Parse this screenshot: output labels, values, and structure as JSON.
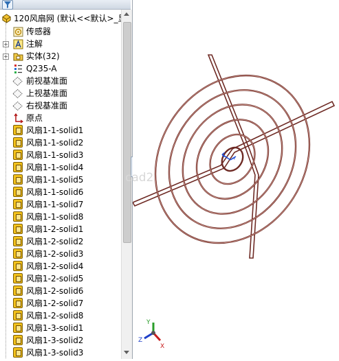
{
  "tree": {
    "root_label": "120风扇网  (默认<<默认>_显",
    "items": [
      {
        "label": "传感器",
        "icon": "sensor-icon"
      },
      {
        "label": "注解",
        "icon": "annotation-icon",
        "expandable": true
      },
      {
        "label": "实体(32)",
        "icon": "solid-bodies-folder-icon",
        "expandable": true
      },
      {
        "label": "Q235-A",
        "icon": "material-icon"
      },
      {
        "label": "前视基准面",
        "icon": "plane-icon"
      },
      {
        "label": "上视基准面",
        "icon": "plane-icon"
      },
      {
        "label": "右视基准面",
        "icon": "plane-icon"
      },
      {
        "label": "原点",
        "icon": "origin-icon"
      },
      {
        "label": "风扇1-1-solid1",
        "icon": "body-icon"
      },
      {
        "label": "风扇1-1-solid2",
        "icon": "body-icon"
      },
      {
        "label": "风扇1-1-solid3",
        "icon": "body-icon"
      },
      {
        "label": "风扇1-1-solid4",
        "icon": "body-icon"
      },
      {
        "label": "风扇1-1-solid5",
        "icon": "body-icon"
      },
      {
        "label": "风扇1-1-solid6",
        "icon": "body-icon"
      },
      {
        "label": "风扇1-1-solid7",
        "icon": "body-icon"
      },
      {
        "label": "风扇1-1-solid8",
        "icon": "body-icon"
      },
      {
        "label": "风扇1-2-solid1",
        "icon": "body-icon"
      },
      {
        "label": "风扇1-2-solid2",
        "icon": "body-icon"
      },
      {
        "label": "风扇1-2-solid3",
        "icon": "body-icon"
      },
      {
        "label": "风扇1-2-solid4",
        "icon": "body-icon"
      },
      {
        "label": "风扇1-2-solid5",
        "icon": "body-icon"
      },
      {
        "label": "风扇1-2-solid6",
        "icon": "body-icon"
      },
      {
        "label": "风扇1-2-solid7",
        "icon": "body-icon"
      },
      {
        "label": "风扇1-2-solid8",
        "icon": "body-icon"
      },
      {
        "label": "风扇1-3-solid1",
        "icon": "body-icon"
      },
      {
        "label": "风扇1-3-solid2",
        "icon": "body-icon"
      },
      {
        "label": "风扇1-3-solid3",
        "icon": "body-icon"
      }
    ]
  },
  "viewport": {
    "watermark": "cad2",
    "model_color": "#6e2a24",
    "triad": {
      "y_label": "Y",
      "z_label": "Z",
      "x_label": "X"
    }
  }
}
